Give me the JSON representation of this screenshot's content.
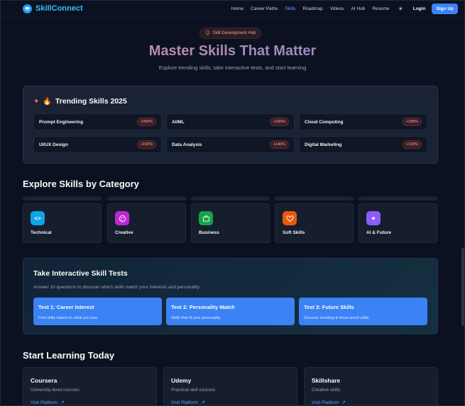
{
  "nav": {
    "brand": "SkillConnect",
    "links": [
      "Home",
      "Career Paths",
      "Skills",
      "Roadmap",
      "Videos",
      "AI Hub",
      "Resume"
    ],
    "active": "Skills",
    "login": "Login",
    "signup": "Sign Up"
  },
  "hero": {
    "badge": "Skill Development Hub",
    "title": "Master Skills That Matter",
    "subtitle": "Explore trending skills, take interactive tests, and start learning"
  },
  "trending": {
    "title": "Trending Skills 2025",
    "skills": [
      {
        "name": "Prompt Engineering",
        "growth": "+350%"
      },
      {
        "name": "AI/ML",
        "growth": "+200%"
      },
      {
        "name": "Cloud Computing",
        "growth": "+180%"
      },
      {
        "name": "UI/UX Design",
        "growth": "+150%"
      },
      {
        "name": "Data Analysis",
        "growth": "+140%"
      },
      {
        "name": "Digital Marketing",
        "growth": "+130%"
      }
    ]
  },
  "categories": {
    "title": "Explore Skills by Category",
    "items": [
      {
        "label": "Technical",
        "icon": "code-icon",
        "color": "#0ea5e9"
      },
      {
        "label": "Creative",
        "icon": "palette-icon",
        "color": "#c026d3"
      },
      {
        "label": "Business",
        "icon": "briefcase-icon",
        "color": "#16a34a"
      },
      {
        "label": "Soft Skills",
        "icon": "heart-icon",
        "color": "#ea580c"
      },
      {
        "label": "AI & Future",
        "icon": "sparkles-icon",
        "color": "#8b5cf6"
      }
    ]
  },
  "tests": {
    "title": "Take Interactive Skill Tests",
    "subtitle": "Answer 10 questions to discover which skills match your interests and personality",
    "items": [
      {
        "title": "Test 1: Career Interest",
        "desc": "Find skills based on what you love"
      },
      {
        "title": "Test 2: Personality Match",
        "desc": "Skills that fit your personality"
      },
      {
        "title": "Test 3: Future Skills",
        "desc": "Discover trending & future-proof skills"
      }
    ]
  },
  "learning": {
    "title": "Start Learning Today",
    "platforms": [
      {
        "name": "Coursera",
        "desc": "University-level courses",
        "link": "Visit Platform"
      },
      {
        "name": "Udemy",
        "desc": "Practical skill courses",
        "link": "Visit Platform"
      },
      {
        "name": "Skillshare",
        "desc": "Creative skills",
        "link": "Visit Platform"
      }
    ]
  },
  "colors": {
    "accent": "#3b82f6",
    "brand": "#38bdf8",
    "background": "#0b1120"
  }
}
